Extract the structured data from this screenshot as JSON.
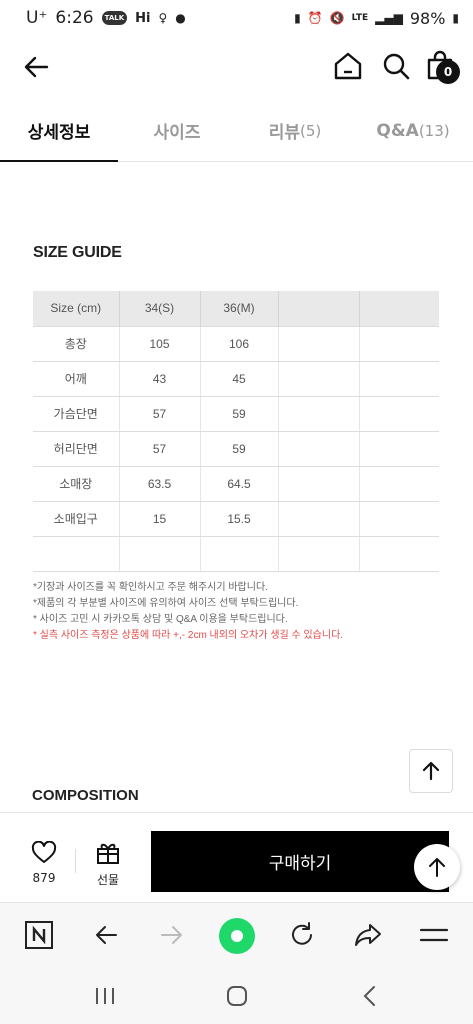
{
  "status_bar": {
    "carrier": "U⁺",
    "time": "6:26",
    "talk": "TALK",
    "hi": "Hi",
    "network": "LTE",
    "battery": "98%"
  },
  "header": {
    "cart_count": "0"
  },
  "tabs": [
    {
      "label": "상세정보",
      "count": "",
      "active": true
    },
    {
      "label": "사이즈",
      "count": "",
      "active": false
    },
    {
      "label": "리뷰",
      "count": "(5)",
      "active": false
    },
    {
      "label": "Q&A",
      "count": "(13)",
      "active": false
    }
  ],
  "size_guide": {
    "title": "SIZE GUIDE",
    "headers": [
      "Size (cm)",
      "34(S)",
      "36(M)",
      "",
      ""
    ],
    "rows": [
      [
        "총장",
        "105",
        "106",
        "",
        ""
      ],
      [
        "어깨",
        "43",
        "45",
        "",
        ""
      ],
      [
        "가슴단면",
        "57",
        "59",
        "",
        ""
      ],
      [
        "허리단면",
        "57",
        "59",
        "",
        ""
      ],
      [
        "소매장",
        "63.5",
        "64.5",
        "",
        ""
      ],
      [
        "소매입구",
        "15",
        "15.5",
        "",
        ""
      ],
      [
        "",
        "",
        "",
        "",
        ""
      ]
    ],
    "notes": [
      "*기장과 사이즈를 꼭 확인하시고 주문 해주시기 바랍니다.",
      "*제품의 각 부분별 사이즈에 유의하여 사이즈 선택 부탁드립니다.",
      "* 사이즈 고민 시 카카오톡 상담 및 Q&A 이용을 부탁드립니다."
    ],
    "warning": "* 실측 사이즈 측정은 상품에 따라 +,- 2cm 내외의 오차가 생길 수 있습니다."
  },
  "composition": {
    "title": "COMPOSITION"
  },
  "buy_bar": {
    "like_count": "879",
    "gift_label": "선물",
    "purchase_label": "구매하기"
  },
  "colors": {
    "accent_green": "#1ed86a",
    "warning_red": "#e24a4a",
    "purchase_bg": "#000000"
  }
}
